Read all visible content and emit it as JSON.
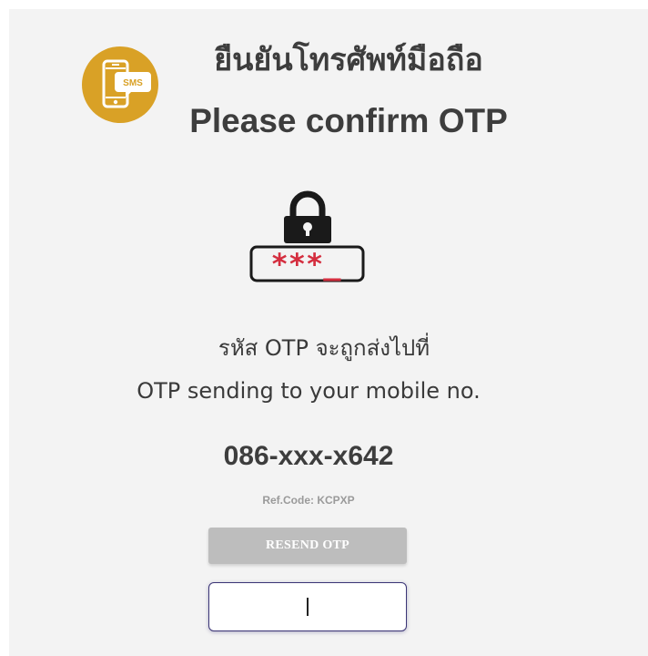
{
  "header": {
    "title_thai": "ยืนยันโทรศัพท์มือถือ",
    "title_en": "Please confirm OTP",
    "sms_icon_text": "SMS",
    "badge_color": "#d9a126"
  },
  "lock_graphic": {
    "masked_text": "***_",
    "asterisk_color": "#d42e3f"
  },
  "message": {
    "send_thai": "รหัส OTP จะถูกส่งไปที่",
    "send_en": "OTP sending to your mobile no.",
    "phone_number": "086-xxx-x642",
    "ref_code": "Ref.Code: KCPXP"
  },
  "actions": {
    "resend_label": "RESEND OTP",
    "otp_value": "",
    "otp_placeholder": ""
  }
}
